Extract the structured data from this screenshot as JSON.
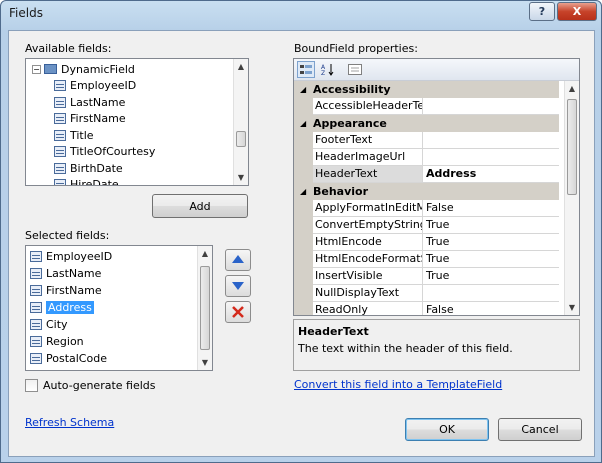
{
  "window": {
    "title": "Fields",
    "help_label": "?",
    "close_label": "X"
  },
  "available": {
    "label": "Available fields:",
    "items": [
      {
        "label": "DynamicField",
        "icon": "folder-icon"
      },
      {
        "label": "EmployeeID"
      },
      {
        "label": "LastName"
      },
      {
        "label": "FirstName"
      },
      {
        "label": "Title"
      },
      {
        "label": "TitleOfCourtesy"
      },
      {
        "label": "BirthDate"
      },
      {
        "label": "HireDate"
      }
    ]
  },
  "add_button": "Add",
  "selected": {
    "label": "Selected fields:",
    "items": [
      {
        "label": "EmployeeID"
      },
      {
        "label": "LastName"
      },
      {
        "label": "FirstName"
      },
      {
        "label": "Address",
        "selected": true
      },
      {
        "label": "City"
      },
      {
        "label": "Region"
      },
      {
        "label": "PostalCode"
      }
    ]
  },
  "autogen_label": "Auto-generate fields",
  "refresh_link": "Refresh Schema",
  "properties": {
    "label": "BoundField properties:",
    "rows": [
      {
        "type": "category",
        "name": "Accessibility"
      },
      {
        "type": "prop",
        "name": "AccessibleHeaderText",
        "value": ""
      },
      {
        "type": "category",
        "name": "Appearance"
      },
      {
        "type": "prop",
        "name": "FooterText",
        "value": ""
      },
      {
        "type": "prop",
        "name": "HeaderImageUrl",
        "value": ""
      },
      {
        "type": "prop",
        "name": "HeaderText",
        "value": "Address",
        "highlight": true
      },
      {
        "type": "category",
        "name": "Behavior"
      },
      {
        "type": "prop",
        "name": "ApplyFormatInEditMode",
        "value": "False"
      },
      {
        "type": "prop",
        "name": "ConvertEmptyStringToNull",
        "value": "True"
      },
      {
        "type": "prop",
        "name": "HtmlEncode",
        "value": "True"
      },
      {
        "type": "prop",
        "name": "HtmlEncodeFormatString",
        "value": "True"
      },
      {
        "type": "prop",
        "name": "InsertVisible",
        "value": "True"
      },
      {
        "type": "prop",
        "name": "NullDisplayText",
        "value": ""
      },
      {
        "type": "prop",
        "name": "ReadOnly",
        "value": "False"
      }
    ],
    "description_title": "HeaderText",
    "description_text": "The text within the header of this field."
  },
  "convert_link": "Convert this field into a TemplateField",
  "ok_button": "OK",
  "cancel_button": "Cancel"
}
